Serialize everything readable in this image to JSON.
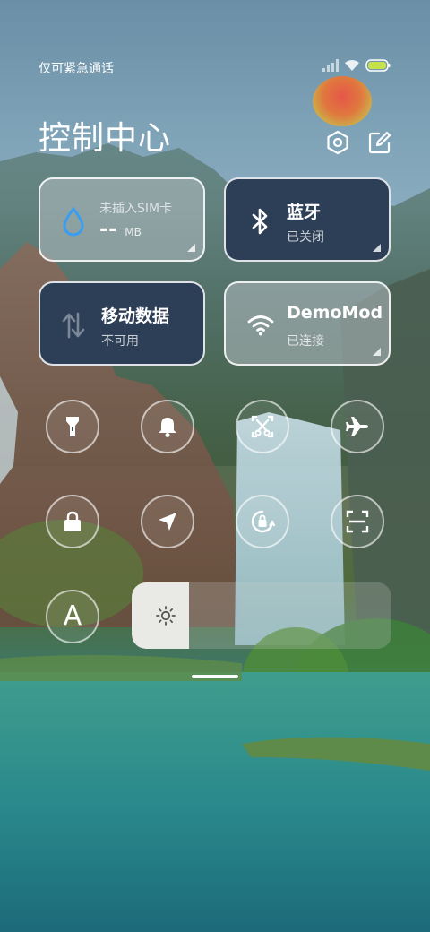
{
  "status_bar": {
    "carrier_text": "仅可紧急通话",
    "battery_color": "#c6e24a"
  },
  "header": {
    "title": "控制中心",
    "settings_icon": "settings-hexagon-icon",
    "edit_icon": "edit-icon"
  },
  "tiles": [
    {
      "id": "data-usage",
      "title": "未插入SIM卡",
      "value": "--",
      "unit": "MB",
      "icon": "water-drop-icon",
      "style": "light"
    },
    {
      "id": "bluetooth",
      "title": "蓝牙",
      "subtitle": "已关闭",
      "icon": "bluetooth-icon",
      "style": "dark"
    },
    {
      "id": "mobile-data",
      "title": "移动数据",
      "subtitle": "不可用",
      "icon": "mobile-data-arrows-icon",
      "style": "dark"
    },
    {
      "id": "wifi",
      "title": "DemoMod",
      "subtitle": "已连接",
      "icon": "wifi-icon",
      "style": "light"
    }
  ],
  "toggles": [
    {
      "id": "flashlight",
      "icon": "flashlight-icon"
    },
    {
      "id": "ringer",
      "icon": "bell-icon"
    },
    {
      "id": "screenshot",
      "icon": "screenshot-scissors-icon"
    },
    {
      "id": "airplane",
      "icon": "airplane-icon"
    },
    {
      "id": "lock",
      "icon": "lock-icon"
    },
    {
      "id": "location",
      "icon": "location-arrow-icon"
    },
    {
      "id": "rotation-lock",
      "icon": "rotation-lock-icon"
    },
    {
      "id": "scanner",
      "icon": "scan-icon"
    },
    {
      "id": "auto-brightness",
      "icon": "auto-brightness-a-icon",
      "label": "A"
    }
  ],
  "brightness": {
    "level": 0.22,
    "icon": "sun-icon"
  },
  "colors": {
    "accent_blue": "#3a9ef0",
    "tile_dark": "#2d3f57"
  }
}
